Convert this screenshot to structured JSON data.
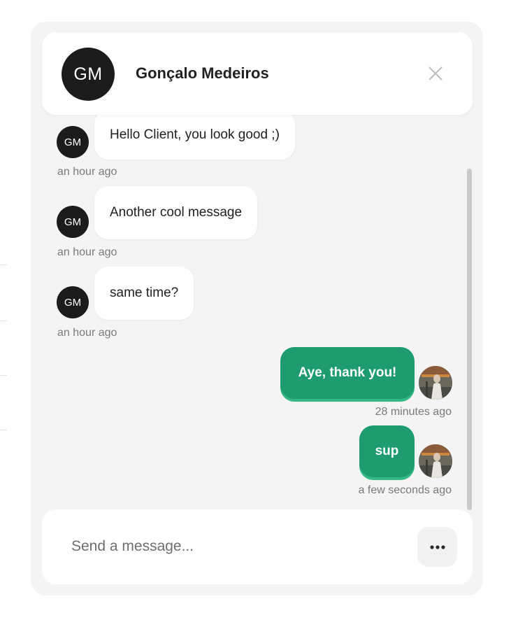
{
  "header": {
    "avatar_initials": "GM",
    "contact_name": "Gonçalo Medeiros"
  },
  "messages": [
    {
      "direction": "incoming",
      "avatar_initials": "GM",
      "text": "Hello Client, you look good ;)",
      "time": "an hour ago"
    },
    {
      "direction": "incoming",
      "avatar_initials": "GM",
      "text": "Another cool message",
      "time": "an hour ago"
    },
    {
      "direction": "incoming",
      "avatar_initials": "GM",
      "text": "same time?",
      "time": "an hour ago"
    },
    {
      "direction": "outgoing",
      "text": "Aye, thank you!",
      "time": "28 minutes ago"
    },
    {
      "direction": "outgoing",
      "text": "sup",
      "time": "a few seconds ago"
    }
  ],
  "composer": {
    "placeholder": "Send a message...",
    "more_icon": "more-horizontal-icon"
  },
  "icons": {
    "close": "close-icon",
    "more": "more-horizontal-icon"
  },
  "colors": {
    "outgoing_bubble": "#1e9c70",
    "outgoing_bubble_shadow": "#33b886",
    "avatar_dark": "#1b1b1b",
    "panel_background": "#f4f4f4"
  }
}
